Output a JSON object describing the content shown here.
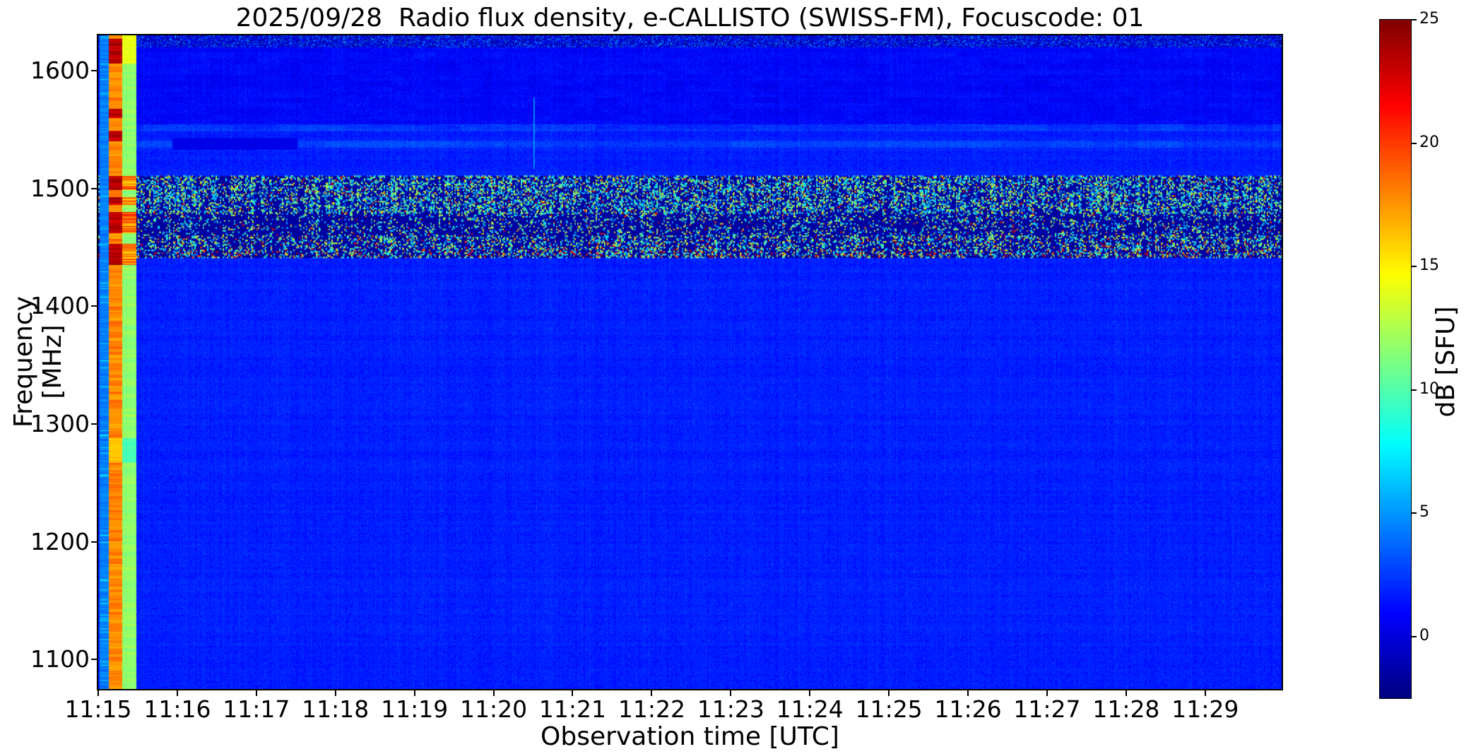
{
  "chart_data": {
    "type": "heatmap",
    "subtype": "radio-spectrogram",
    "title": "2025/09/28  Radio flux density, e-CALLISTO (SWISS-FM), Focuscode: 01",
    "xlabel": "Observation time [UTC]",
    "ylabel": "Frequency [MHz]",
    "colorbar_label": "dB [SFU]",
    "colormap": "jet",
    "grid": false,
    "legend": "none",
    "x_ticks": [
      "11:15",
      "11:16",
      "11:17",
      "11:18",
      "11:19",
      "11:20",
      "11:21",
      "11:22",
      "11:23",
      "11:24",
      "11:25",
      "11:26",
      "11:27",
      "11:28",
      "11:29"
    ],
    "y_ticks": [
      1600,
      1500,
      1400,
      1300,
      1200,
      1100
    ],
    "colorbar_ticks": [
      25,
      20,
      15,
      10,
      5,
      0
    ],
    "xlim": [
      "11:15:00",
      "11:29:58"
    ],
    "ylim_mhz": [
      1075,
      1630
    ],
    "clim_db": [
      -2.5,
      25
    ],
    "background_level_db": 1.5,
    "features": {
      "calibration_bar": {
        "description": "bright calibration column at start of file",
        "sub_columns": [
          {
            "t0_s": 1,
            "t1_s": 8,
            "level_db": 3.6
          },
          {
            "t0_s": 8,
            "t1_s": 18,
            "level_db": 17.3
          },
          {
            "t0_s": 18,
            "t1_s": 29,
            "level_db": 11.3
          }
        ],
        "hot_rows_mhz": [
          [
            1606,
            1627
          ],
          [
            1560,
            1568
          ],
          [
            1540,
            1549
          ],
          [
            1499,
            1511
          ],
          [
            1486,
            1493
          ],
          [
            1462,
            1480
          ],
          [
            1435,
            1453
          ]
        ]
      },
      "top_speckle_band_mhz": [
        1620,
        1630
      ],
      "quiet_dark_band_mhz": [
        1550,
        1620
      ],
      "bright_lines_mhz": [
        1553,
        1539
      ],
      "dark_streak": {
        "f_mhz": [
          1533,
          1543
        ],
        "t_start_s": 56,
        "t_end_s": 151
      },
      "vertical_streak": {
        "t_s": 330,
        "f_mhz": [
          1517,
          1577
        ]
      },
      "rfi_band": {
        "f_mhz": [
          1441,
          1511
        ],
        "sub_bands": [
          {
            "f_mhz": [
              1479,
              1511
            ],
            "speckle_density": 0.36,
            "hot_fraction": 0.07
          },
          {
            "f_mhz": [
              1460,
              1479
            ],
            "speckle_density": 0.17,
            "hot_fraction": 0.1
          },
          {
            "f_mhz": [
              1448,
              1460
            ],
            "speckle_density": 0.3,
            "hot_fraction": 0.15
          },
          {
            "f_mhz": [
              1441,
              1448
            ],
            "speckle_density": 0.34,
            "hot_fraction": 0.3
          }
        ]
      }
    }
  }
}
